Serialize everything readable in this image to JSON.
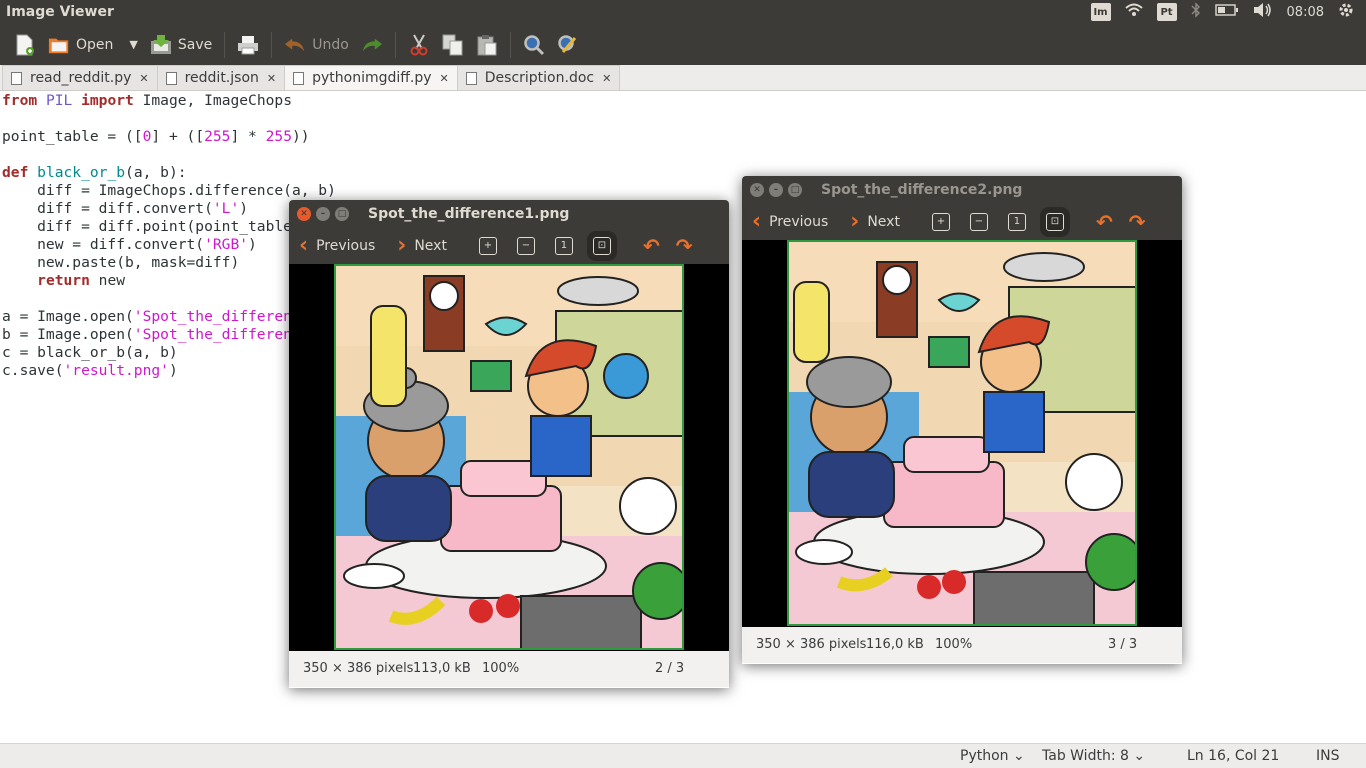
{
  "topbar": {
    "title": "Image Viewer",
    "indicators": {
      "keyboard": "Pt",
      "time": "08:08"
    }
  },
  "toolbar": {
    "open_label": "Open",
    "save_label": "Save",
    "undo_label": "Undo"
  },
  "tabs": [
    {
      "label": "read_reddit.py"
    },
    {
      "label": "reddit.json"
    },
    {
      "label": "pythonimgdiff.py"
    },
    {
      "label": "Description.doc"
    }
  ],
  "code": {
    "lines": [
      "from PIL import Image, ImageChops",
      "",
      "point_table = ([0] + ([255] * 255))",
      "",
      "def black_or_b(a, b):",
      "    diff = ImageChops.difference(a, b)",
      "    diff = diff.convert('L')",
      "    diff = diff.point(point_table)",
      "    new = diff.convert('RGB')",
      "    new.paste(b, mask=diff)",
      "    return new",
      "",
      "a = Image.open('Spot_the_difference1.png')",
      "b = Image.open('Spot_the_difference2.png')",
      "c = black_or_b(a, b)",
      "c.save('result.png')"
    ]
  },
  "statusbar": {
    "language": "Python",
    "tab_width": "Tab Width: 8",
    "position": "Ln 16, Col 21",
    "mode": "INS"
  },
  "viewer1": {
    "title": "Spot_the_difference1.png",
    "previous": "Previous",
    "next": "Next",
    "dims": "350 × 386 pixels",
    "size": "113,0 kB",
    "zoom": "100%",
    "page": "2 / 3"
  },
  "viewer2": {
    "title": "Spot_the_difference2.png",
    "previous": "Previous",
    "next": "Next",
    "dims": "350 × 386 pixels",
    "size": "116,0 kB",
    "zoom": "100%",
    "page": "3 / 3"
  },
  "colors": {
    "accent": "#e8702a",
    "title_bar": "#3c3b37",
    "image_border": "#2e9b3e"
  }
}
